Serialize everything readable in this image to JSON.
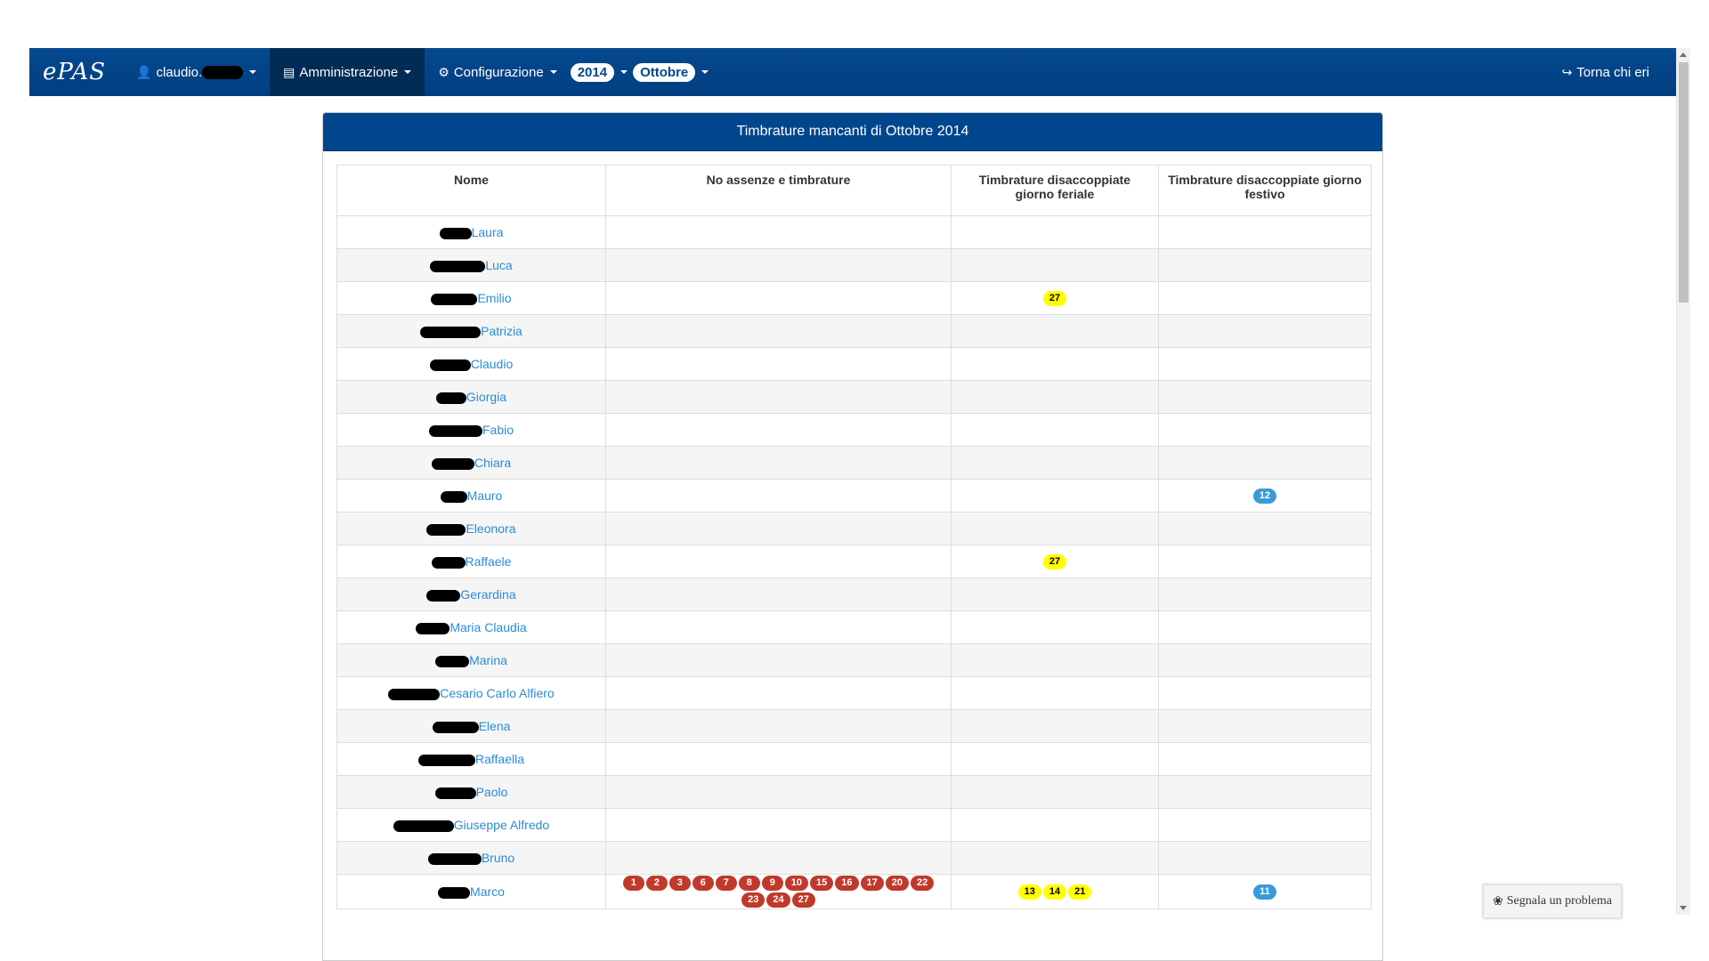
{
  "navbar": {
    "brand": "ePAS",
    "user": "claudio.",
    "admin": "Amministrazione",
    "config": "Configurazione",
    "year": "2014",
    "month": "Ottobre",
    "back": "Torna chi eri"
  },
  "panel": {
    "title": "Timbrature mancanti di Ottobre 2014"
  },
  "table": {
    "headers": [
      "Nome",
      "No assenze e timbrature",
      "Timbrature disaccoppiate giorno feriale",
      "Timbrature disaccoppiate giorno festivo"
    ],
    "rows": [
      {
        "name": "Laura",
        "redact_w": 36,
        "no_abs": [],
        "feriale": [],
        "festivo": []
      },
      {
        "name": "Luca",
        "redact_w": 62,
        "no_abs": [],
        "feriale": [],
        "festivo": []
      },
      {
        "name": "Emilio",
        "redact_w": 52,
        "no_abs": [],
        "feriale": [
          "27"
        ],
        "festivo": []
      },
      {
        "name": "Patrizia",
        "redact_w": 68,
        "no_abs": [],
        "feriale": [],
        "festivo": []
      },
      {
        "name": "Claudio",
        "redact_w": 46,
        "no_abs": [],
        "feriale": [],
        "festivo": []
      },
      {
        "name": "Giorgia",
        "redact_w": 34,
        "no_abs": [],
        "feriale": [],
        "festivo": []
      },
      {
        "name": "Fabio",
        "redact_w": 60,
        "no_abs": [],
        "feriale": [],
        "festivo": []
      },
      {
        "name": "Chiara",
        "redact_w": 48,
        "no_abs": [],
        "feriale": [],
        "festivo": []
      },
      {
        "name": "Mauro",
        "redact_w": 30,
        "no_abs": [],
        "feriale": [],
        "festivo": [
          "12"
        ]
      },
      {
        "name": "Eleonora",
        "redact_w": 44,
        "no_abs": [],
        "feriale": [],
        "festivo": []
      },
      {
        "name": "Raffaele",
        "redact_w": 38,
        "no_abs": [],
        "feriale": [
          "27"
        ],
        "festivo": []
      },
      {
        "name": "Gerardina",
        "redact_w": 38,
        "no_abs": [],
        "feriale": [],
        "festivo": []
      },
      {
        "name": "Maria Claudia",
        "redact_w": 38,
        "no_abs": [],
        "feriale": [],
        "festivo": []
      },
      {
        "name": "Marina",
        "redact_w": 38,
        "no_abs": [],
        "feriale": [],
        "festivo": []
      },
      {
        "name": "Cesario Carlo Alfiero",
        "redact_w": 58,
        "no_abs": [],
        "feriale": [],
        "festivo": []
      },
      {
        "name": "Elena",
        "redact_w": 52,
        "no_abs": [],
        "feriale": [],
        "festivo": []
      },
      {
        "name": "Raffaella",
        "redact_w": 64,
        "no_abs": [],
        "feriale": [],
        "festivo": []
      },
      {
        "name": "Paolo",
        "redact_w": 46,
        "no_abs": [],
        "feriale": [],
        "festivo": []
      },
      {
        "name": "Giuseppe Alfredo",
        "redact_w": 68,
        "no_abs": [],
        "feriale": [],
        "festivo": []
      },
      {
        "name": "Bruno",
        "redact_w": 60,
        "no_abs": [],
        "feriale": [],
        "festivo": []
      },
      {
        "name": "Marco",
        "redact_w": 36,
        "no_abs": [
          "1",
          "2",
          "3",
          "6",
          "7",
          "8",
          "9",
          "10",
          "15",
          "16",
          "17",
          "20",
          "22",
          "23",
          "24",
          "27"
        ],
        "feriale": [
          "13",
          "14",
          "21"
        ],
        "festivo": [
          "11"
        ]
      }
    ]
  },
  "report_button": "Segnala un problema",
  "colors": {
    "navbar": "#00468c",
    "badge_yellow": "#ffff00",
    "badge_blue": "#3a9ad9",
    "badge_red": "#c0392b",
    "link": "#2a8bd8"
  }
}
